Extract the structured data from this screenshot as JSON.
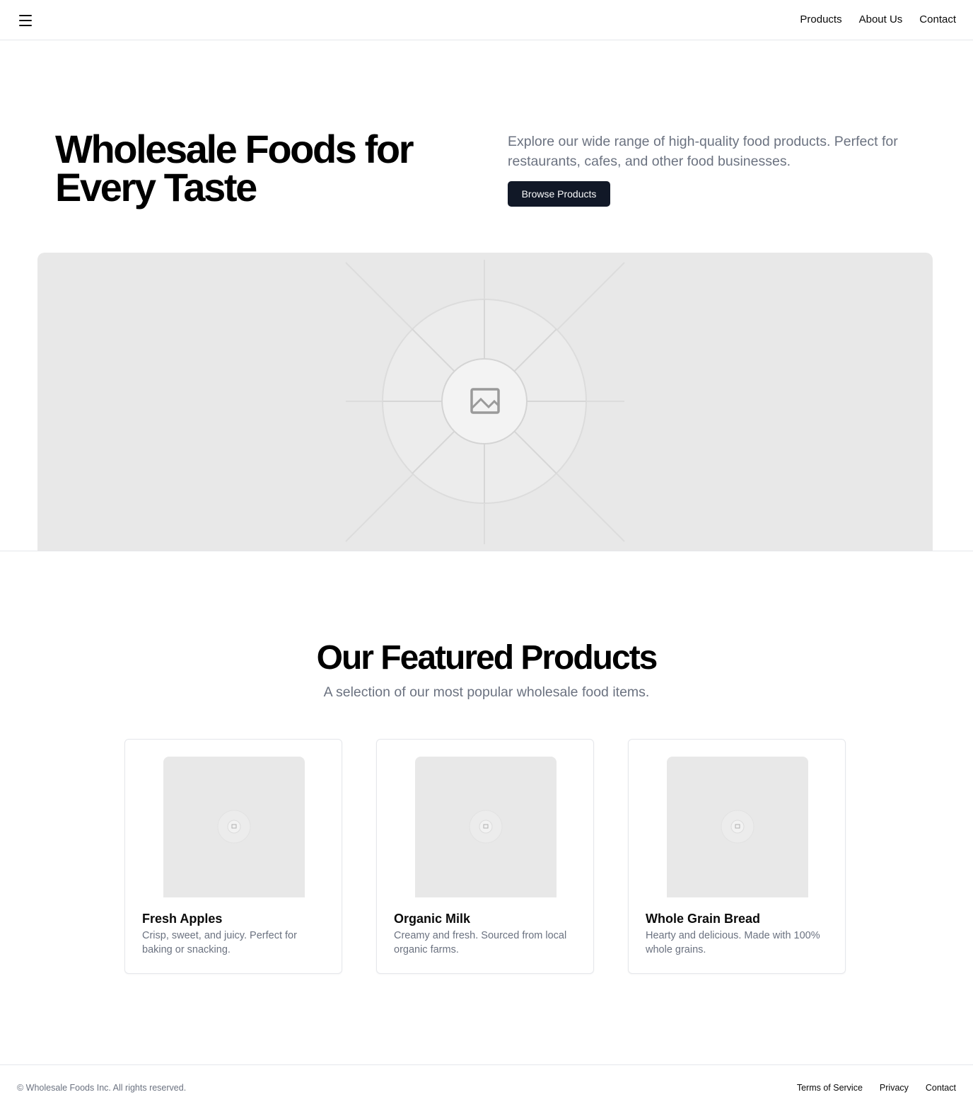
{
  "header": {
    "menu_icon": "hamburger-menu-icon",
    "nav": [
      "Products",
      "About Us",
      "Contact"
    ]
  },
  "hero": {
    "title": "Wholesale Foods for Every Taste",
    "description": "Explore our wide range of high-quality food products. Perfect for restaurants, cafes, and other food businesses.",
    "cta_label": "Browse Products",
    "image_icon": "image-placeholder-icon"
  },
  "featured": {
    "title": "Our Featured Products",
    "subtitle": "A selection of our most popular wholesale food items.",
    "products": [
      {
        "name": "Fresh Apples",
        "description": "Crisp, sweet, and juicy. Perfect for baking or snacking."
      },
      {
        "name": "Organic Milk",
        "description": "Creamy and fresh. Sourced from local organic farms."
      },
      {
        "name": "Whole Grain Bread",
        "description": "Hearty and delicious. Made with 100% whole grains."
      }
    ]
  },
  "footer": {
    "copyright": "© Wholesale Foods Inc. All rights reserved.",
    "links": [
      "Terms of Service",
      "Privacy",
      "Contact"
    ]
  },
  "colors": {
    "primary_button": "#111827",
    "muted_text": "#6b7280",
    "border": "#e5e7eb",
    "placeholder_bg": "#e8e8e8"
  }
}
